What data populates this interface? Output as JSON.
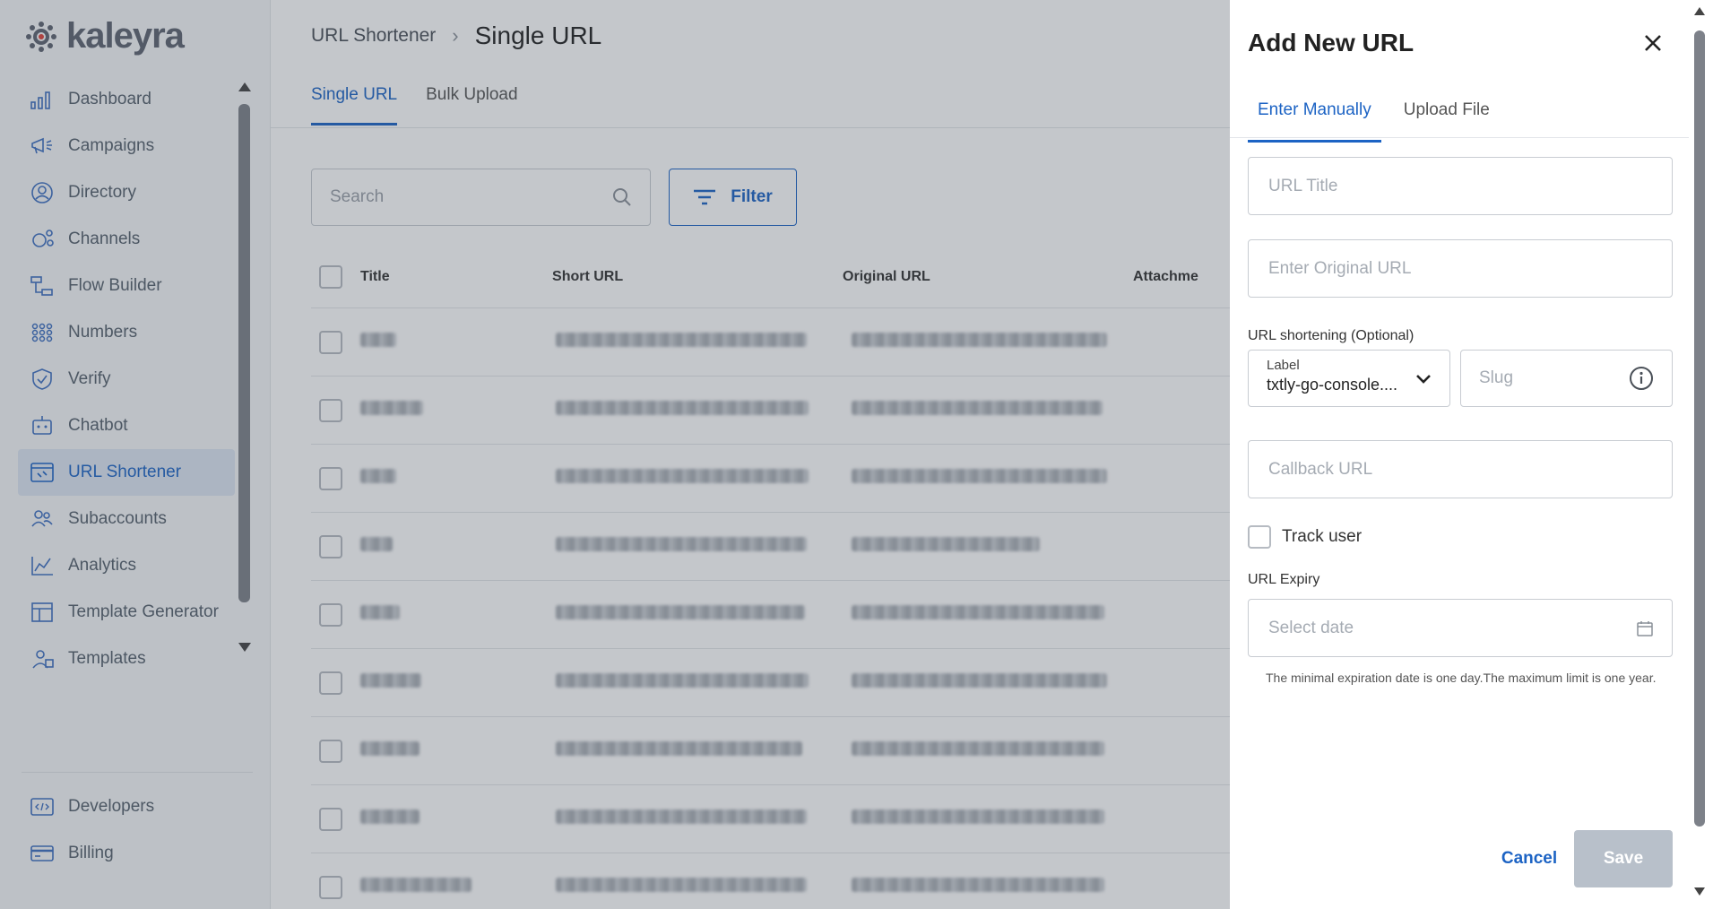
{
  "brand": {
    "name": "kaleyra",
    "accent": "#1c63c4"
  },
  "sidebar": {
    "items": [
      {
        "label": "Dashboard",
        "icon": "dashboard-icon"
      },
      {
        "label": "Campaigns",
        "icon": "megaphone-icon"
      },
      {
        "label": "Directory",
        "icon": "contact-icon"
      },
      {
        "label": "Channels",
        "icon": "channels-icon"
      },
      {
        "label": "Flow Builder",
        "icon": "flow-builder-icon"
      },
      {
        "label": "Numbers",
        "icon": "numbers-grid-icon"
      },
      {
        "label": "Verify",
        "icon": "shield-check-icon"
      },
      {
        "label": "Chatbot",
        "icon": "chatbot-icon"
      },
      {
        "label": "URL Shortener",
        "icon": "link-icon",
        "active": true
      },
      {
        "label": "Subaccounts",
        "icon": "users-icon"
      },
      {
        "label": "Analytics",
        "icon": "analytics-icon"
      },
      {
        "label": "Template Generator",
        "icon": "template-generator-icon"
      },
      {
        "label": "Templates",
        "icon": "templates-icon"
      }
    ],
    "bottom_items": [
      {
        "label": "Developers",
        "icon": "code-icon"
      },
      {
        "label": "Billing",
        "icon": "billing-card-icon"
      }
    ]
  },
  "header": {
    "breadcrumb_parent": "URL Shortener",
    "breadcrumb_current": "Single URL"
  },
  "main": {
    "tabs": [
      {
        "label": "Single URL"
      },
      {
        "label": "Bulk Upload"
      }
    ],
    "search": {
      "placeholder": "Search"
    },
    "filter_label": "Filter",
    "table": {
      "columns": [
        "Title",
        "Short URL",
        "Original URL",
        "Attachme"
      ],
      "rows_visible": 9
    }
  },
  "drawer": {
    "title": "Add New URL",
    "tabs": [
      {
        "label": "Enter Manually"
      },
      {
        "label": "Upload File"
      }
    ],
    "url_title_placeholder": "URL Title",
    "original_url_placeholder": "Enter Original URL",
    "shortening_label": "URL shortening (Optional)",
    "label_caption": "Label",
    "label_value": "txtly-go-console....",
    "slug_placeholder": "Slug",
    "callback_placeholder": "Callback URL",
    "track_user_label": "Track user",
    "expiry_label": "URL Expiry",
    "date_placeholder": "Select date",
    "hint": "The minimal expiration date is one day.The maximum limit is one year.",
    "cancel_label": "Cancel",
    "save_label": "Save"
  }
}
